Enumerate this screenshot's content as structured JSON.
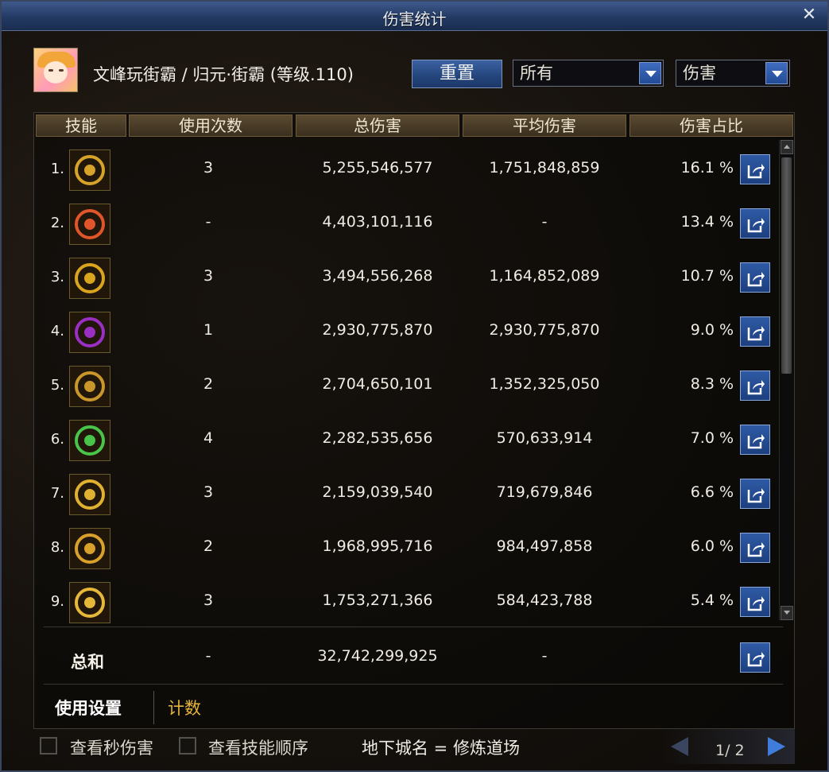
{
  "window": {
    "title": "伤害统计",
    "close": "✕"
  },
  "header": {
    "character": "文峰玩街霸 / 归元·街霸 (等级.110)",
    "reset_button": "重置",
    "filter_select": "所有",
    "type_select": "伤害"
  },
  "table": {
    "columns": [
      "技能",
      "使用次数",
      "总伤害",
      "平均伤害",
      "伤害占比"
    ],
    "rows": [
      {
        "rank": "1.",
        "icon": "skull-star-skill-icon",
        "color": "#d6a22a",
        "uses": "3",
        "total": "5,255,546,577",
        "avg": "1,751,848,859",
        "pct": "16.1 %"
      },
      {
        "rank": "2.",
        "icon": "fire-claw-skill-icon",
        "color": "#e0552a",
        "uses": "-",
        "total": "4,403,101,116",
        "avg": "-",
        "pct": "13.4 %"
      },
      {
        "rank": "3.",
        "icon": "spiral-skill-icon",
        "color": "#d9a51f",
        "uses": "3",
        "total": "3,494,556,268",
        "avg": "1,164,852,089",
        "pct": "10.7 %"
      },
      {
        "rank": "4.",
        "icon": "purple-flame-skill-icon",
        "color": "#9a2fc4",
        "uses": "1",
        "total": "2,930,775,870",
        "avg": "2,930,775,870",
        "pct": "9.0 %"
      },
      {
        "rank": "5.",
        "icon": "burst-skill-icon",
        "color": "#c9962a",
        "uses": "2",
        "total": "2,704,650,101",
        "avg": "1,352,325,050",
        "pct": "8.3 %"
      },
      {
        "rank": "6.",
        "icon": "green-jar-skill-icon",
        "color": "#49c44a",
        "uses": "4",
        "total": "2,282,535,656",
        "avg": "570,633,914",
        "pct": "7.0 %"
      },
      {
        "rank": "7.",
        "icon": "slash-skill-icon",
        "color": "#e0b030",
        "uses": "3",
        "total": "2,159,039,540",
        "avg": "719,679,846",
        "pct": "6.6 %"
      },
      {
        "rank": "8.",
        "icon": "fang-skill-icon",
        "color": "#d8a12c",
        "uses": "2",
        "total": "1,968,995,716",
        "avg": "984,497,858",
        "pct": "6.0 %"
      },
      {
        "rank": "9.",
        "icon": "crown-ring-skill-icon",
        "color": "#e6b83a",
        "uses": "3",
        "total": "1,753,271,366",
        "avg": "584,423,788",
        "pct": "5.4 %"
      }
    ],
    "total": {
      "label": "总和",
      "uses": "-",
      "total": "32,742,299,925",
      "avg": "-"
    }
  },
  "tabs": {
    "usage_settings": "使用设置",
    "count": "计数"
  },
  "footer": {
    "show_dps_label": "查看秒伤害",
    "show_skill_order_label": "查看技能顺序",
    "dungeon": "地下城名 = 修炼道场",
    "page": "1/ 2"
  },
  "colors": {
    "accent_blue": "#2f5aa4",
    "tab_active": "#ffffff",
    "tab_inactive": "#e7b43a"
  }
}
